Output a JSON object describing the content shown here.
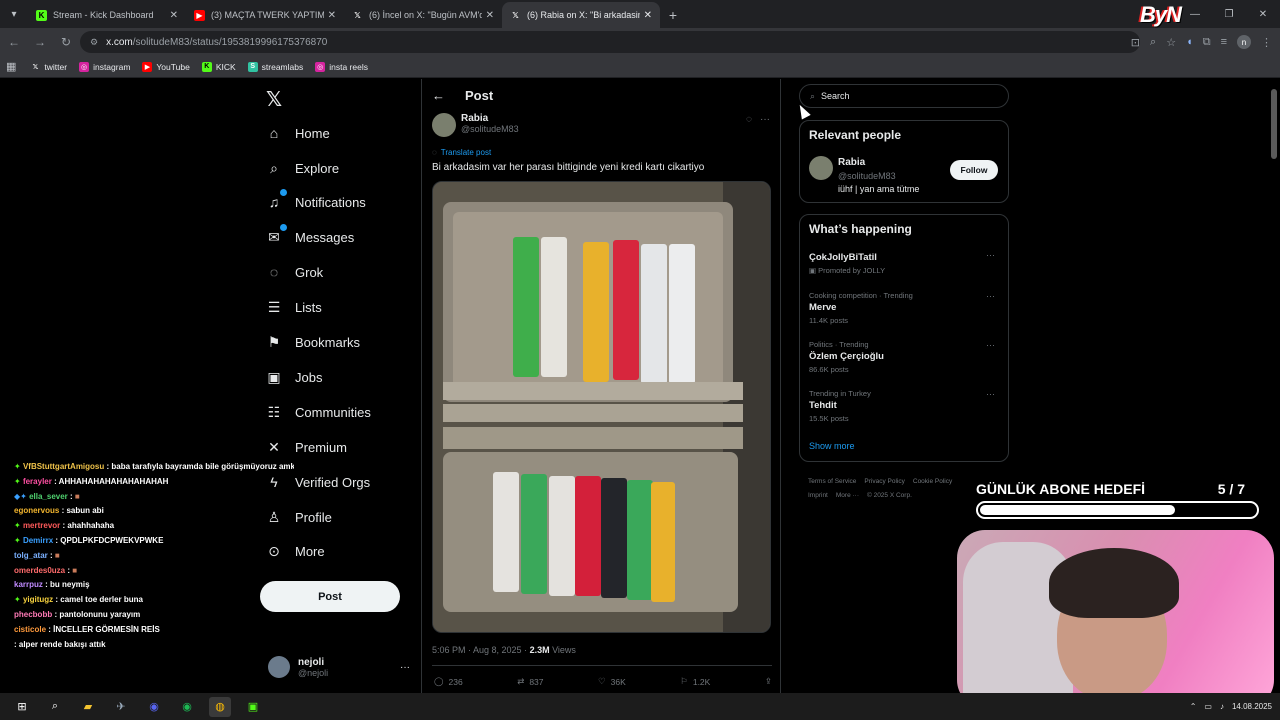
{
  "browser": {
    "tabs": [
      {
        "label": "Stream - Kick Dashboard",
        "icon": "kick-icon",
        "color": "#53fc18"
      },
      {
        "label": "(3) MAÇTA TWERK YAPTIM | İLK",
        "icon": "youtube-icon",
        "color": "#ff0000"
      },
      {
        "label": "(6) İncel on X: \"Bugün AVM'de",
        "icon": "x-icon",
        "color": "#ffffff"
      },
      {
        "label": "(6) Rabia on X: \"Bi arkadasim va",
        "icon": "x-icon",
        "color": "#ffffff"
      }
    ],
    "url_host": "x.com",
    "url_path": "/solitudeM83/status/1953819996175376870",
    "bookmarks": [
      "twitter",
      "instagram",
      "YouTube",
      "KICK",
      "streamlabs",
      "insta reels"
    ],
    "profile_initial": "n"
  },
  "overlay_logo": "ByN",
  "nav": {
    "items": [
      "Home",
      "Explore",
      "Notifications",
      "Messages",
      "Grok",
      "Lists",
      "Bookmarks",
      "Jobs",
      "Communities",
      "Premium",
      "Verified Orgs",
      "Profile",
      "More"
    ],
    "post_button": "Post",
    "account_name": "nejoli",
    "account_handle": "@nejoli"
  },
  "post": {
    "header": "Post",
    "author_name": "Rabia",
    "author_handle": "@solitudeM83",
    "translate": "Translate post",
    "text": "Bi arkadasim var her parası bittiginde yeni kredi kartı cikartiyo",
    "time": "5:06 PM · Aug 8, 2025 · ",
    "views_count": "2.3M",
    "views_label": " Views",
    "replies": "236",
    "reposts": "837",
    "likes": "36K",
    "bookmarks": "1.2K"
  },
  "sidebar": {
    "search_placeholder": "Search",
    "relevant_title": "Relevant people",
    "person_name": "Rabia",
    "person_handle": "@solitudeM83",
    "person_bio": "iühf | yan ama tütme",
    "follow": "Follow",
    "happening_title": "What’s happening",
    "trends": [
      {
        "context": "",
        "name": "ÇokJollyBiTatil",
        "meta": "Promoted by JOLLY"
      },
      {
        "context": "Cooking competition · Trending",
        "name": "Merve",
        "meta": "11.4K posts"
      },
      {
        "context": "Politics · Trending",
        "name": "Özlem Çerçioğlu",
        "meta": "86.6K posts"
      },
      {
        "context": "Trending in Turkey",
        "name": "Tehdit",
        "meta": "15.5K posts"
      }
    ],
    "show_more": "Show more",
    "footer_links": [
      "Terms of Service",
      "Privacy Policy",
      "Cookie Policy",
      "Imprint",
      "More ···",
      "© 2025 X Corp."
    ]
  },
  "chat": [
    {
      "user": "VfBStuttgartAmigosu",
      "color": "#f0c34a",
      "text": " : baba tarafıyla bayramda bile görüşmüyoruz amk"
    },
    {
      "user": "ferayler",
      "color": "#ff4fa3",
      "text": " : AHHAHAHAHAHAHAHAHAH"
    },
    {
      "user": "ella_sever",
      "color": "#4fd16f",
      "text": " : "
    },
    {
      "user": "egonervous",
      "color": "#f2b52e",
      "text": " : sabun abi"
    },
    {
      "user": "mertrevor",
      "color": "#ff5a5a",
      "text": " : ahahhahaha"
    },
    {
      "user": "Demirrx",
      "color": "#3aa0ff",
      "text": " : QPDLPKFDCPWEKVPWKE"
    },
    {
      "user": "tolg_atar",
      "color": "#7ab0ff",
      "text": " : "
    },
    {
      "user": "omerdes0uza",
      "color": "#ff6b6b",
      "text": " : "
    },
    {
      "user": "karrpuz",
      "color": "#c08bff",
      "text": " : bu neymiş"
    },
    {
      "user": "yigitugz",
      "color": "#f7d23e",
      "text": " : camel toe derler buna"
    },
    {
      "user": "phecbobb",
      "color": "#ff7ab6",
      "text": " : pantolonunu yarayım"
    },
    {
      "user": "cisticole",
      "color": "#ff9a3c",
      "text": " : İNCELLER GÖRMESİN REİS"
    },
    {
      "user": "",
      "color": "#ffffff",
      "text": ": alper rende bakışı attık"
    }
  ],
  "goal": {
    "label": "GÜNLÜK ABONE HEDEFİ",
    "count": "5 / 7",
    "progress": 0.71
  },
  "taskbar": {
    "date": "14.08.2025"
  }
}
